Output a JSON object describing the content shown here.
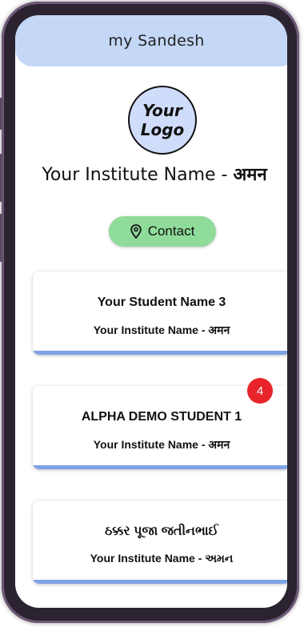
{
  "app": {
    "title": "my Sandesh"
  },
  "logo": {
    "line1": "Your",
    "line2": "Logo"
  },
  "institute": {
    "name_en": "Your Institute Name - ",
    "name_hi": "अमन"
  },
  "contact": {
    "label": "Contact",
    "icon": "location-pin-icon"
  },
  "students": [
    {
      "name": "Your Student Name 3",
      "institute": "Your Institute Name - अमन",
      "badge": ""
    },
    {
      "name": "ALPHA DEMO STUDENT 1",
      "institute": "Your Institute Name - अमन",
      "badge": "4"
    },
    {
      "name": "ઠક્કર પૂજા જતીનભાઈ",
      "institute": "Your Institute Name - અમન",
      "badge": ""
    }
  ],
  "colors": {
    "appbar": "#c4d7f7",
    "logo_bg": "#cfdcfa",
    "contact_bg": "#8fdb9a",
    "card_accent": "#7ea3e6",
    "badge": "#e8232a"
  }
}
